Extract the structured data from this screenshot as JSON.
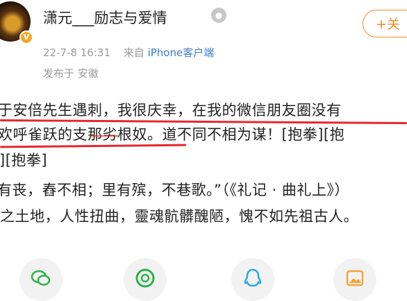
{
  "post": {
    "username": "潇元___励志与爱情",
    "follow_label": "+关",
    "time": "22-7-8 16:31",
    "source_prefix": "来自",
    "source_device": "iPhone客户端",
    "location": "发布于 安徽",
    "lines": [
      "于安倍先生遇刺，我很庆幸，在我的微信朋友圈没有",
      "欢呼雀跃的支那劣根奴。道不同不相为谋！[抱拳][抱",
      "][抱拳]",
      "有丧，舂不相；里有殡，不巷歌。”（《礼记 · 曲礼上》）",
      "之土地，人性扭曲，靈魂骯髒醜陋，愧不如先祖古人。"
    ]
  },
  "colors": {
    "accent": "#f08a2a",
    "link": "#3e7bc4",
    "underline": "#e8262d",
    "muted": "#9a9a9a"
  },
  "share_icons": [
    "wechat-icon",
    "moments-icon",
    "qq-icon",
    "album-icon"
  ]
}
